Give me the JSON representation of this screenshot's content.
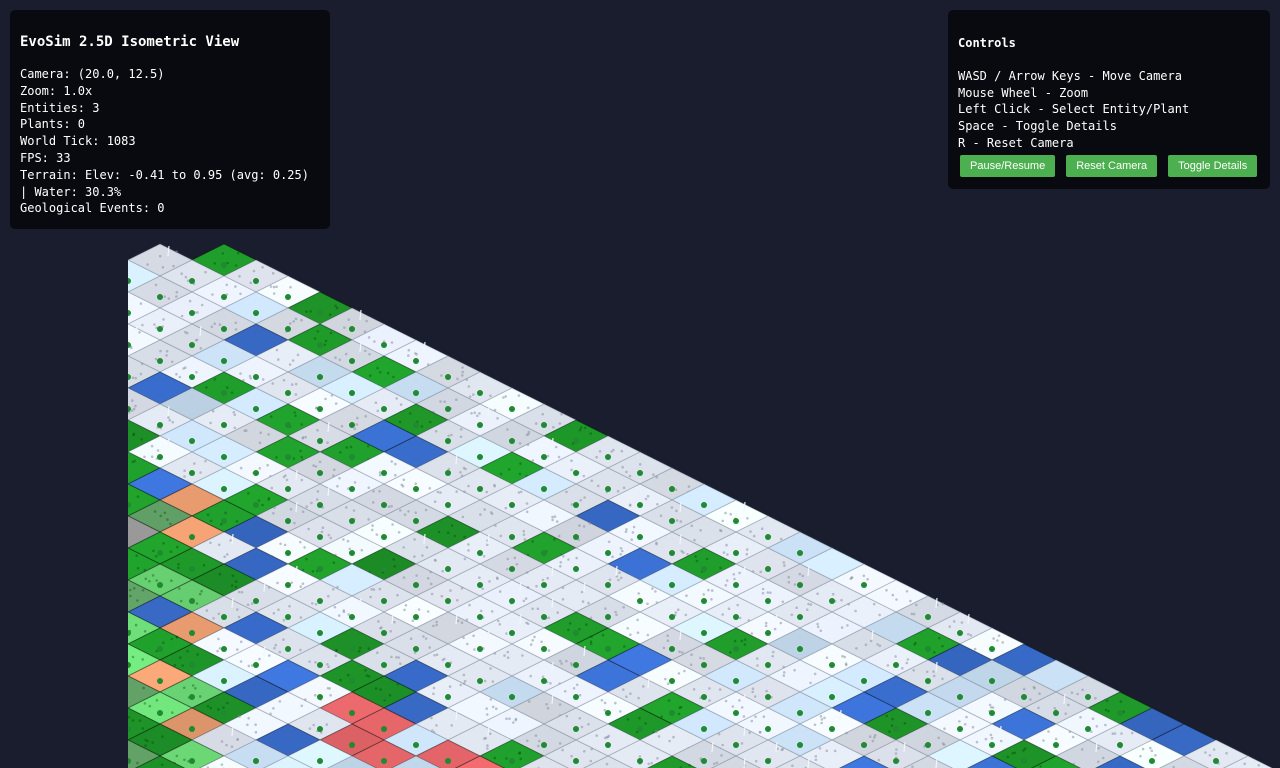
{
  "info": {
    "title": "EvoSim 2.5D Isometric View",
    "camera": "Camera: (20.0, 12.5)",
    "zoom": "Zoom: 1.0x",
    "entities": "Entities: 3",
    "plants": "Plants: 0",
    "world_tick": "World Tick: 1083",
    "fps": "FPS: 33",
    "terrain": "Terrain: Elev: -0.41 to 0.95 (avg: 0.25)",
    "water": "| Water: 30.3%",
    "geological": "Geological Events: 0"
  },
  "controls": {
    "title": "Controls",
    "lines": [
      "WASD / Arrow Keys - Move Camera",
      "Mouse Wheel - Zoom",
      "Left Click - Select Entity/Plant",
      "Space - Toggle Details",
      "R - Reset Camera"
    ],
    "buttons": {
      "pause": "Pause/Resume",
      "reset": "Reset Camera",
      "details": "Toggle Details"
    }
  },
  "colors": {
    "background": "#1a1d2e",
    "panel": "#08090e",
    "button": "#4caf50",
    "snow": "#e6ecf6",
    "ice": "#cfe6fb",
    "water": "#3a6fd0",
    "grass_dark": "#1f9a2a",
    "grass_light": "#6fe07a",
    "moss": "#5d9a62",
    "sand": "#f2a274",
    "rock": "#9a9a9a",
    "dirt": "#a0541e",
    "desert": "#ef6a6e",
    "plant_dot": "#1f8a30"
  },
  "terrain_legend": [
    "snow",
    "ice",
    "water",
    "grass_dark",
    "grass_light",
    "moss",
    "sand",
    "rock",
    "dirt",
    "desert"
  ]
}
